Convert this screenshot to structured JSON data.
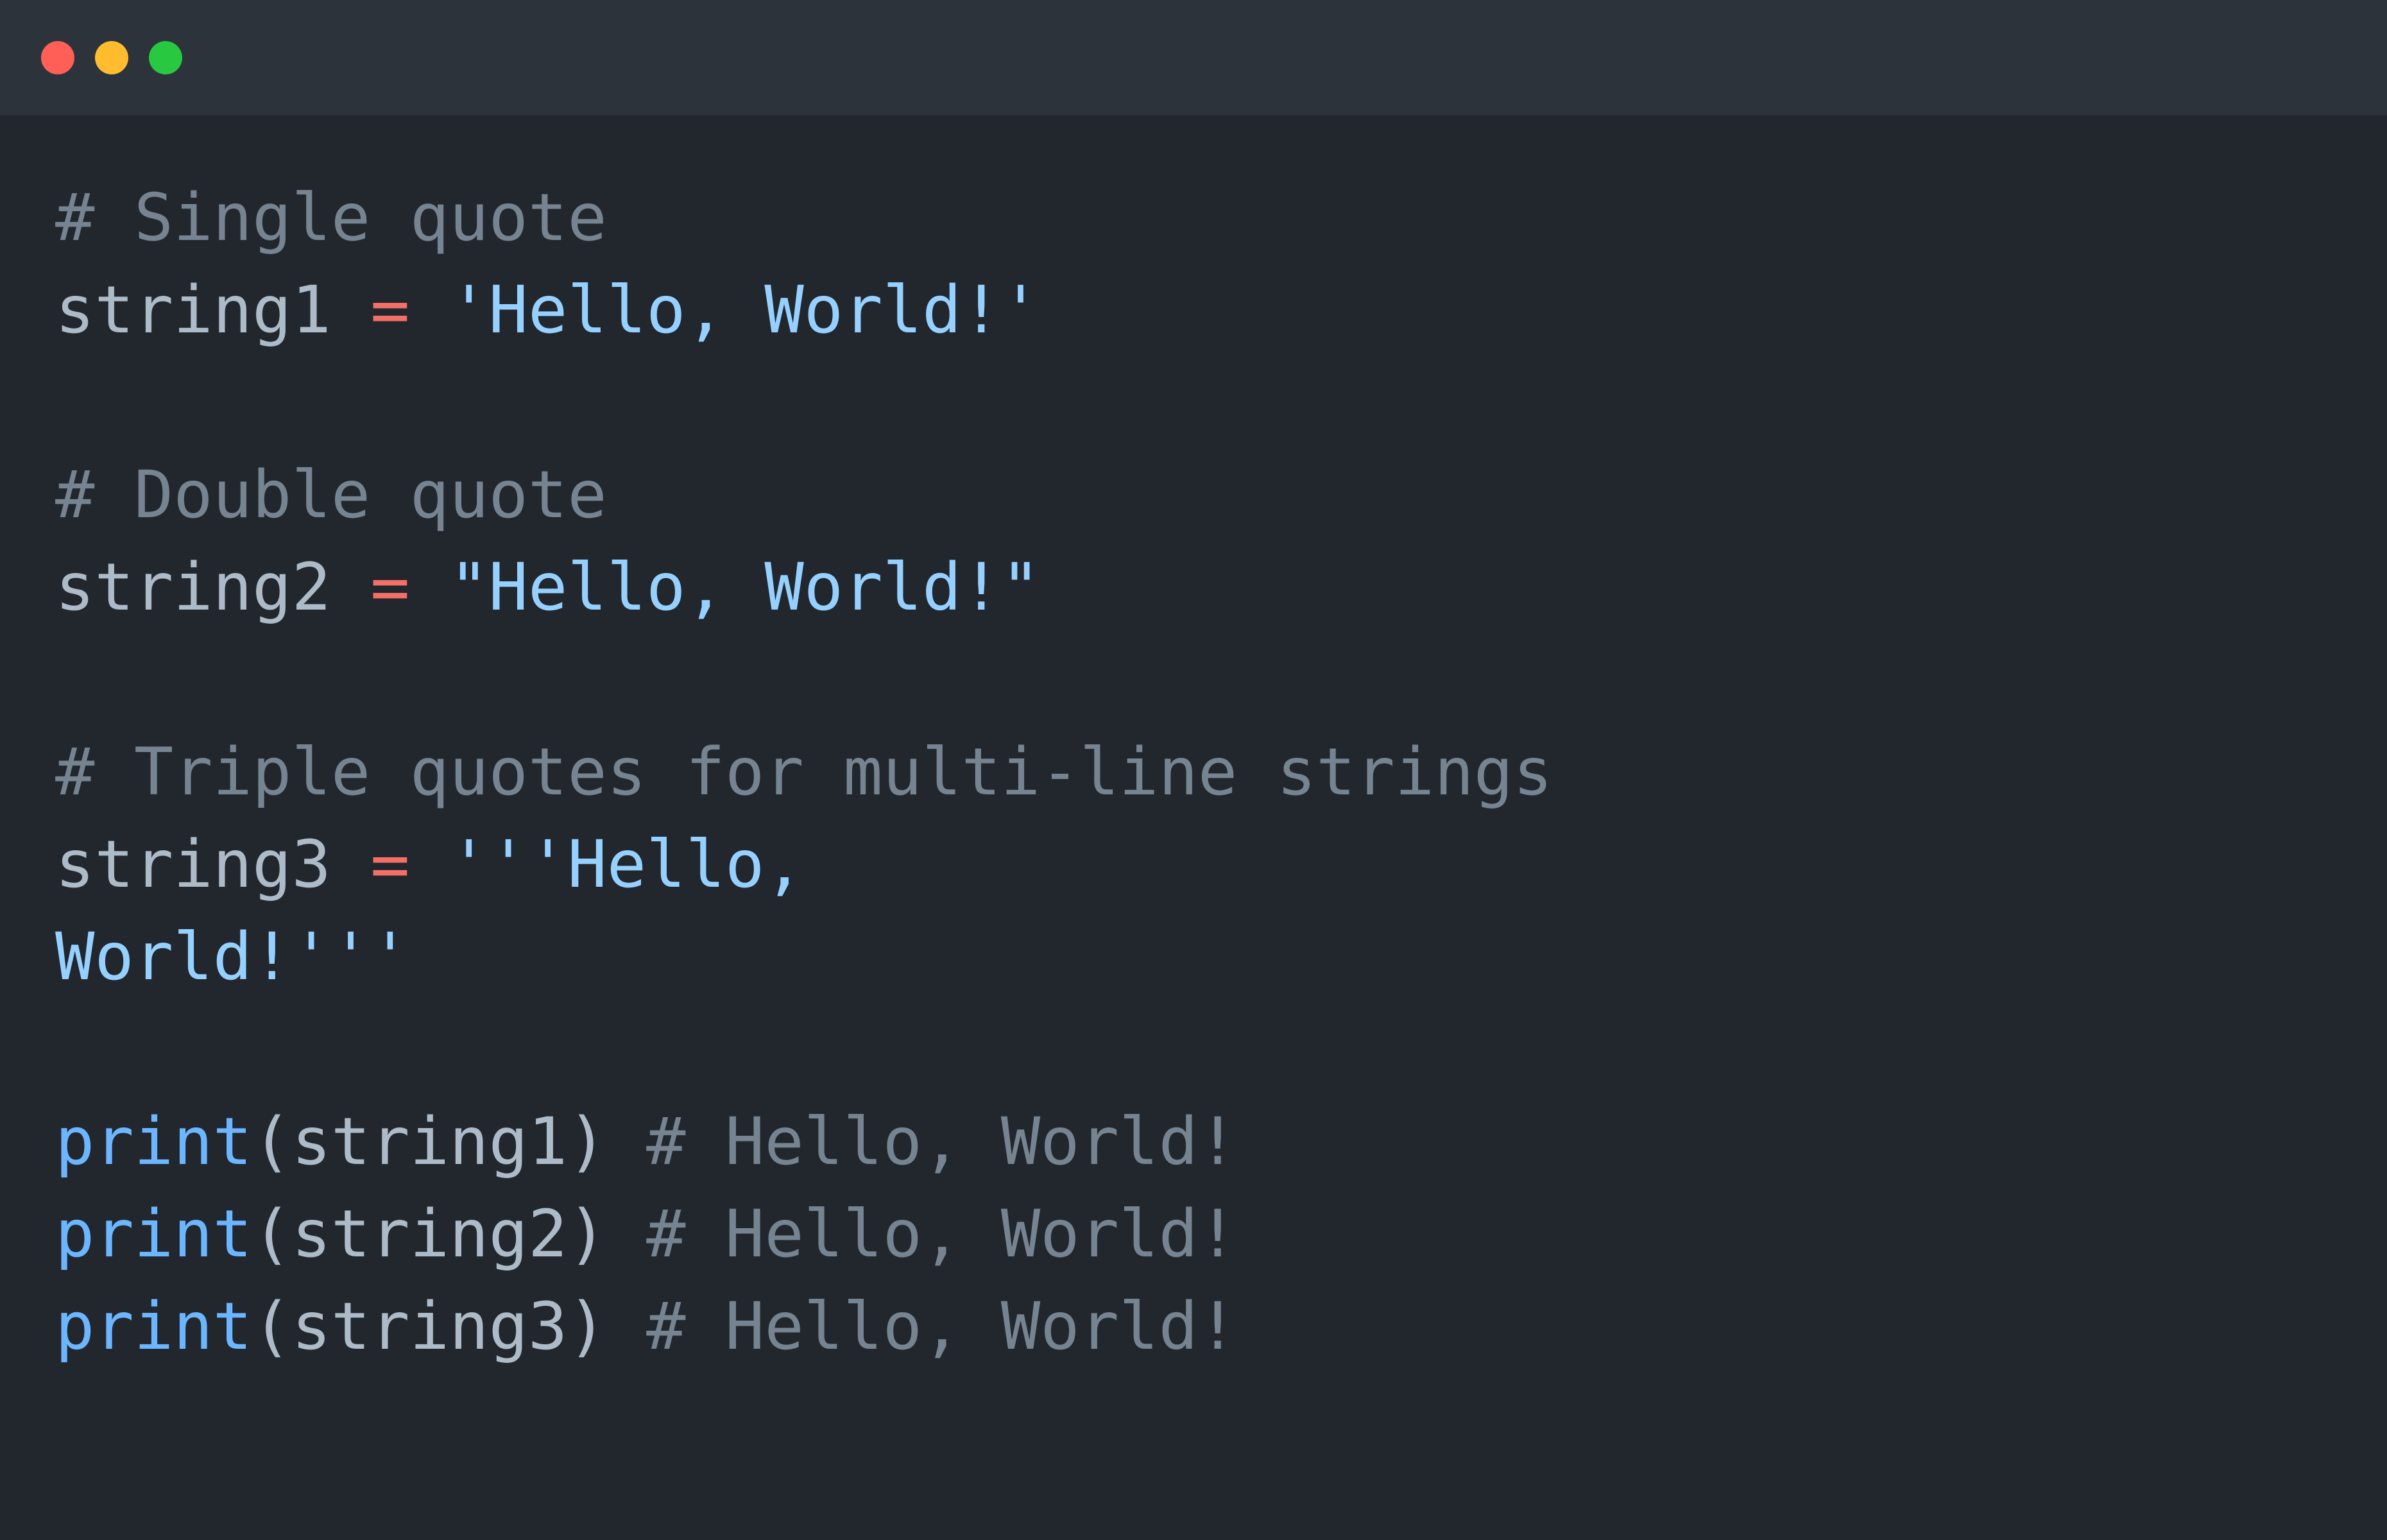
{
  "window": {
    "controls": [
      "close",
      "minimize",
      "maximize"
    ],
    "colors": {
      "close": "#ff5f57",
      "minimize": "#febc2e",
      "maximize": "#28c840",
      "background": "#22272e",
      "titlebar": "#2d333b"
    }
  },
  "code": {
    "language": "python",
    "lines": [
      {
        "tokens": [
          {
            "type": "comment",
            "text": "# Single quote"
          }
        ]
      },
      {
        "tokens": [
          {
            "type": "plain",
            "text": "string1 "
          },
          {
            "type": "op",
            "text": "="
          },
          {
            "type": "plain",
            "text": " "
          },
          {
            "type": "str",
            "text": "'Hello, World!'"
          }
        ]
      },
      {
        "tokens": []
      },
      {
        "tokens": [
          {
            "type": "comment",
            "text": "# Double quote"
          }
        ]
      },
      {
        "tokens": [
          {
            "type": "plain",
            "text": "string2 "
          },
          {
            "type": "op",
            "text": "="
          },
          {
            "type": "plain",
            "text": " "
          },
          {
            "type": "str",
            "text": "\"Hello, World!\""
          }
        ]
      },
      {
        "tokens": []
      },
      {
        "tokens": [
          {
            "type": "comment",
            "text": "# Triple quotes for multi-line strings"
          }
        ]
      },
      {
        "tokens": [
          {
            "type": "plain",
            "text": "string3 "
          },
          {
            "type": "op",
            "text": "="
          },
          {
            "type": "plain",
            "text": " "
          },
          {
            "type": "str",
            "text": "'''Hello,"
          }
        ]
      },
      {
        "tokens": [
          {
            "type": "str",
            "text": "World!'''"
          }
        ]
      },
      {
        "tokens": []
      },
      {
        "tokens": [
          {
            "type": "fn",
            "text": "print"
          },
          {
            "type": "plain",
            "text": "(string1) "
          },
          {
            "type": "comment",
            "text": "# Hello, World!"
          }
        ]
      },
      {
        "tokens": [
          {
            "type": "fn",
            "text": "print"
          },
          {
            "type": "plain",
            "text": "(string2) "
          },
          {
            "type": "comment",
            "text": "# Hello, World!"
          }
        ]
      },
      {
        "tokens": [
          {
            "type": "fn",
            "text": "print"
          },
          {
            "type": "plain",
            "text": "(string3) "
          },
          {
            "type": "comment",
            "text": "# Hello, World!"
          }
        ]
      }
    ]
  }
}
